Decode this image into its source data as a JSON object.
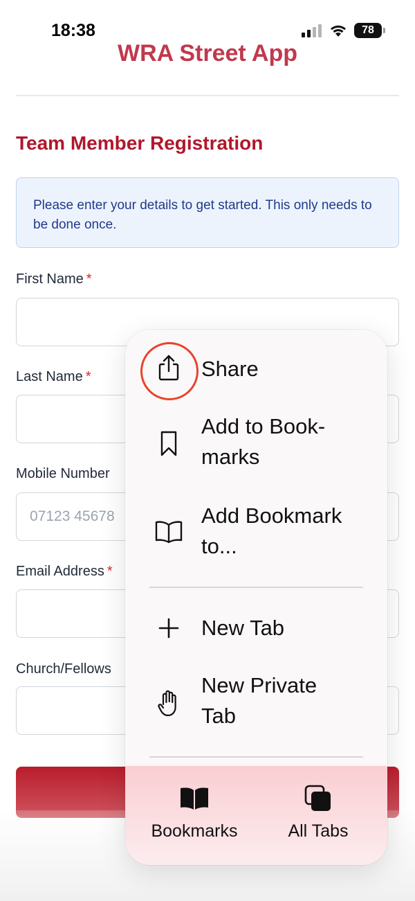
{
  "status_bar": {
    "time": "18:38",
    "battery": "78"
  },
  "app": {
    "title": "WRA Street App"
  },
  "form": {
    "title": "Team Member Registration",
    "info": "Please enter your details to get started. This only needs to be done once.",
    "required_mark": "*",
    "fields": [
      {
        "label": "First Name",
        "value": "",
        "placeholder": ""
      },
      {
        "label": "Last Name",
        "value": "",
        "placeholder": ""
      },
      {
        "label": "Mobile Number",
        "value": "",
        "placeholder": "07123 45678"
      },
      {
        "label": "Email Address",
        "value": "",
        "placeholder": ""
      },
      {
        "label": "Church/Fellows",
        "value": "",
        "placeholder": ""
      }
    ]
  },
  "menu": {
    "items": [
      {
        "label": "Share",
        "icon": "share-icon"
      },
      {
        "label": "Add to Book-\nmarks",
        "icon": "bookmark-icon"
      },
      {
        "label": "Add Bookmark\nto...",
        "icon": "open-book-icon"
      },
      {
        "label": "New Tab",
        "icon": "plus-icon"
      },
      {
        "label": "New Private\nTab",
        "icon": "hand-icon"
      }
    ],
    "bottom": [
      {
        "label": "Bookmarks",
        "icon": "bookmarks-icon"
      },
      {
        "label": "All Tabs",
        "icon": "all-tabs-icon"
      }
    ]
  },
  "colors": {
    "accent": "#b0172b",
    "highlight_ring": "#e8432d"
  }
}
